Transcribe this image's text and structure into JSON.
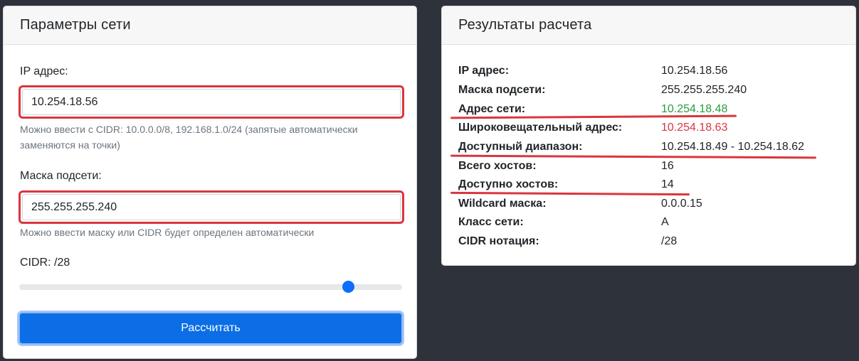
{
  "params": {
    "title": "Параметры сети",
    "ip_label": "IP адрес:",
    "ip_value": "10.254.18.56",
    "ip_help": "Можно ввести с CIDR: 10.0.0.0/8, 192.168.1.0/24 (запятые автоматически заменяются на точки)",
    "mask_label": "Маска подсети:",
    "mask_value": "255.255.255.240",
    "mask_help": "Можно ввести маску или CIDR будет определен автоматически",
    "cidr_label": "CIDR: /28",
    "cidr_slider": {
      "value": 28,
      "min": 0,
      "max": 32
    },
    "calc_button": "Рассчитать"
  },
  "results": {
    "title": "Результаты расчета",
    "rows": [
      {
        "key": "IP адрес:",
        "value": "10.254.18.56"
      },
      {
        "key": "Маска подсети:",
        "value": "255.255.255.240"
      },
      {
        "key": "Адрес сети:",
        "value": "10.254.18.48",
        "color": "#2a9d3c"
      },
      {
        "key": "Широковещательный адрес:",
        "value": "10.254.18.63",
        "color": "#dc3545"
      },
      {
        "key": "Доступный диапазон:",
        "value": "10.254.18.49 - 10.254.18.62"
      },
      {
        "key": "Всего хостов:",
        "value": "16"
      },
      {
        "key": "Доступно хостов:",
        "value": "14"
      },
      {
        "key": "Wildcard маска:",
        "value": "0.0.0.15"
      },
      {
        "key": "Класс сети:",
        "value": "A"
      },
      {
        "key": "CIDR нотация:",
        "value": "/28"
      }
    ]
  },
  "colors": {
    "background": "#2e323a",
    "accent": "#0b6ee6",
    "highlight": "#d9363e"
  }
}
